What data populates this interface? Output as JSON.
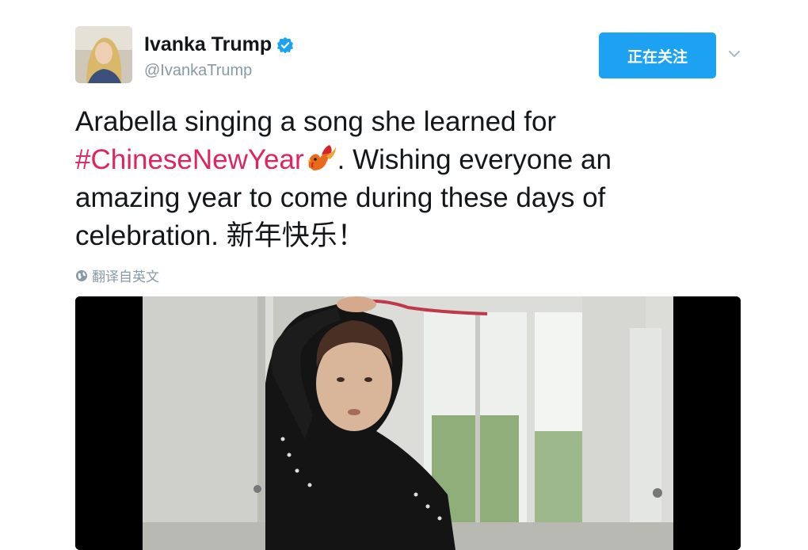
{
  "user": {
    "display_name": "Ivanka Trump",
    "handle": "@IvankaTrump"
  },
  "follow_button": {
    "label": "正在关注"
  },
  "tweet": {
    "line1": "Arabella singing a song she learned for",
    "hashtag": "#ChineseNewYear",
    "rest_line2": ". Wishing everyone an",
    "line3": "amazing year to come during these days of",
    "line4": "celebration.",
    "greeting": "新年快乐！"
  },
  "translate_link": {
    "label": "翻译自英文"
  },
  "colors": {
    "accent": "#1da1f2",
    "hashtag": "#e0245e",
    "secondary_text": "#8899a6"
  },
  "icons": [
    "verified-badge-icon",
    "chevron-down-icon",
    "globe-icon",
    "rooster-emoji-icon"
  ]
}
